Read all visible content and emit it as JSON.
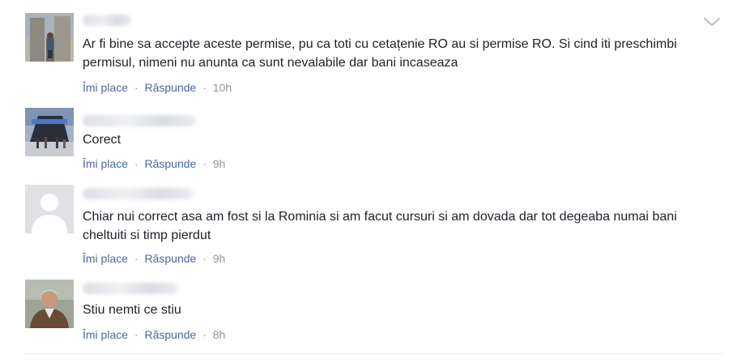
{
  "colors": {
    "text": "#1d2129",
    "link": "#4b67a1",
    "meta": "#90949c"
  },
  "comments": [
    {
      "text": "Ar fi bine sa accepte aceste permise, pu ca toti cu cetațenie RO au si permise RO. Si cind iti preschimbi permisul, nimeni nu anunta ca sunt nevalabile dar bani incaseaza",
      "like_label": "Îmi place",
      "separator": "·",
      "reply_label": "Răspunde",
      "time": "10h"
    },
    {
      "text": "Corect",
      "like_label": "Îmi place",
      "separator": "·",
      "reply_label": "Răspunde",
      "time": "9h"
    },
    {
      "text": "Chiar nui correct asa am fost si la Rominia si am facut cursuri si am dovada dar tot degeaba numai bani cheltuiti si timp pierdut",
      "like_label": "Îmi place",
      "separator": "·",
      "reply_label": "Răspunde",
      "time": "9h"
    },
    {
      "text": "Stiu nemti ce stiu",
      "like_label": "Îmi place",
      "separator": "·",
      "reply_label": "Răspunde",
      "time": "8h"
    }
  ],
  "icons": {
    "options": "chevron-down-icon",
    "default_avatar": "person-silhouette-icon"
  }
}
